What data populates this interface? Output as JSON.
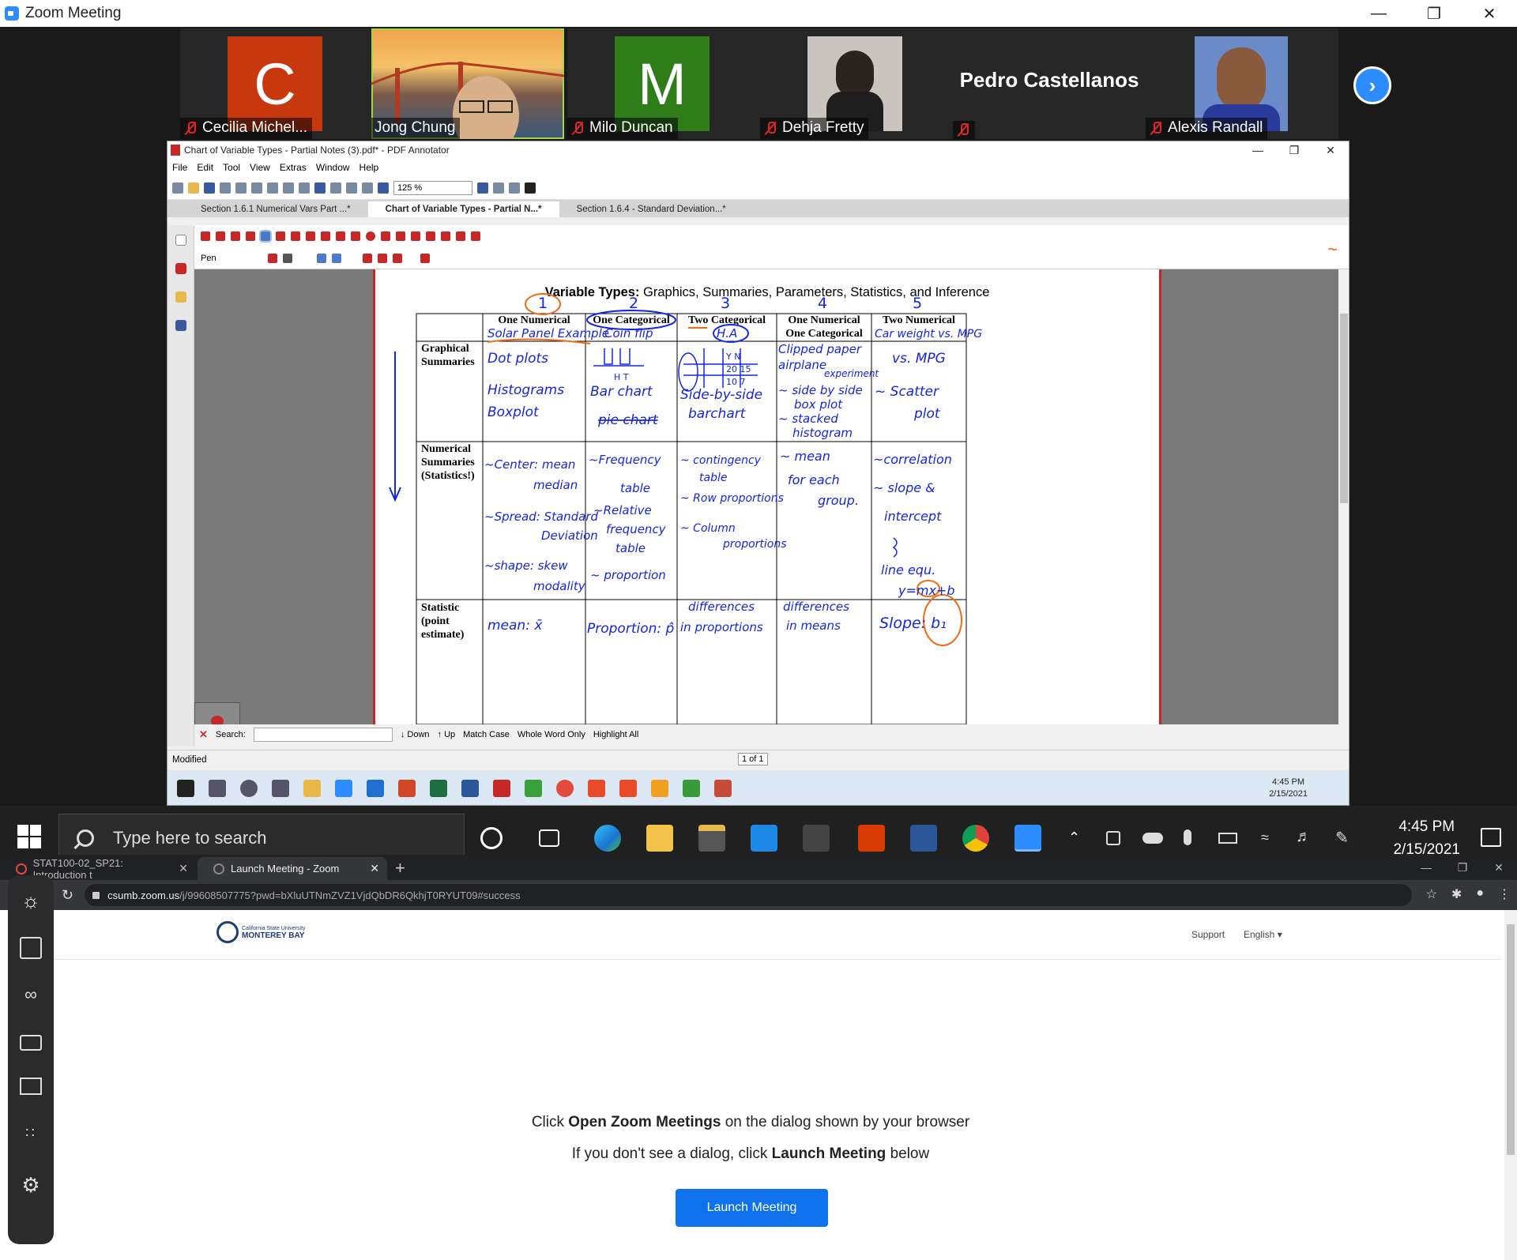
{
  "zoom": {
    "window_title": "Zoom Meeting",
    "participants": [
      {
        "name": "Cecilia Michel...",
        "initial": "C",
        "color": "#c8380e",
        "muted": true
      },
      {
        "name": "Jong Chung",
        "initial": "",
        "color": "",
        "muted": false,
        "active_speaker": true
      },
      {
        "name": "Milo Duncan",
        "initial": "M",
        "color": "#2e7d18",
        "muted": true
      },
      {
        "name": "Dehja Fretty",
        "initial": "",
        "color": "",
        "muted": true
      },
      {
        "name": "Pedro Castellanos",
        "initial": "",
        "color": "",
        "muted": true
      },
      {
        "name": "Alexis Randall",
        "initial": "",
        "color": "",
        "muted": true
      }
    ],
    "next_page_glyph": "›"
  },
  "pdf": {
    "window_title": "Chart of Variable Types - Partial Notes (3).pdf* - PDF Annotator",
    "menu": [
      "File",
      "Edit",
      "Tool",
      "View",
      "Extras",
      "Window",
      "Help"
    ],
    "zoom_level": "125 %",
    "tabs": [
      "Section 1.6.1 Numerical Vars Part ...*",
      "Chart of Variable Types - Partial N...*",
      "Section 1.6.4 - Standard Deviation...*"
    ],
    "active_tab_index": 1,
    "tool_label": "Pen",
    "status": "Modified",
    "page_indicator": "1 of 1",
    "search": {
      "label": "Search:",
      "down": "Down",
      "up": "Up",
      "match_case": "Match Case",
      "whole_word": "Whole Word Only",
      "highlight_all": "Highlight All"
    },
    "clock_time": "4:45 PM",
    "clock_date": "2/15/2021",
    "page_title_bold": "Variable Types:",
    "page_title_rest": " Graphics, Summaries, Parameters, Statistics, and Inference",
    "table": {
      "column_numbers": [
        "1",
        "2",
        "3",
        "4",
        "5"
      ],
      "columns": [
        "One Numerical",
        "One Categorical",
        "Two Categorical",
        "One Numerical\nOne Categorical",
        "Two Numerical"
      ],
      "column_examples": [
        "Solar Panel Example",
        "Coin flip",
        "H.A",
        "",
        "Car weight vs. MPG"
      ],
      "rows": [
        {
          "label": "Graphical\nSummaries",
          "cells": [
            "Dot plots\nHistograms\nBoxplot",
            "Bar chart\npie chart",
            "Side-by-side\nbarchart",
            "~ side by side\nbox plot\n~ stacked\nhistogram",
            "~ Scatter\nplot"
          ]
        },
        {
          "label": "Numerical\nSummaries\n(Statistics!)",
          "cells": [
            "~Center: mean\nmedian\n~Spread: Standard\nDeviation\n~shape: skew\nmodality",
            "~Frequency\ntable\n~Relative\nfrequency\ntable\n~ proportion",
            "~ contingency\ntable\n~ Row proportions\n~ Column\nproportions",
            "~ mean\nfor each\ngroup.",
            "~correlation\n~ slope &\nintercept\nline equ.\ny=mx+b"
          ]
        },
        {
          "label": "Statistic\n(point\nestimate)",
          "cells": [
            "mean: x̄",
            "Proportion: p̂",
            "differences\nin proportions",
            "differences\nin means",
            "Slope: b₁"
          ]
        }
      ],
      "extra_notes": [
        "Clipped paper\nairplane\nexperiment",
        "Y N\n20 15\n10 7"
      ]
    }
  },
  "taskbar": {
    "search_placeholder": "Type here to search",
    "time": "4:45 PM",
    "date": "2/15/2021"
  },
  "chrome": {
    "tabs": [
      {
        "title": "STAT100-02_SP21: Introduction t"
      },
      {
        "title": "Launch Meeting - Zoom"
      }
    ],
    "active_tab_index": 1,
    "url_host": "csumb.zoom.us",
    "url_rest": "/j/99608507775?pwd=bXluUTNmZVZ1VjdQbDR6QkhjT0RYUT09#success",
    "new_tab": "+"
  },
  "page": {
    "logo_line1": "California State University",
    "logo_line2": "MONTEREY BAY",
    "support": "Support",
    "language": "English",
    "msg1_pre": "Click ",
    "msg1_bold": "Open Zoom Meetings",
    "msg1_post": " on the dialog shown by your browser",
    "msg2_pre": "If you don't see a dialog, click ",
    "msg2_bold": "Launch Meeting",
    "msg2_post": " below",
    "launch_button": "Launch Meeting"
  },
  "colors": {
    "zoom_blue": "#2d8cff",
    "launch_blue": "#0e72ed",
    "ink_blue": "#1426e0",
    "ink_orange": "#f06a14",
    "annot_red": "#c62828"
  }
}
